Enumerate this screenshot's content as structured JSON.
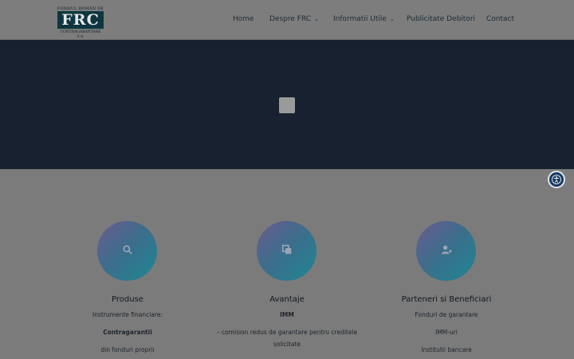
{
  "header": {
    "logo": {
      "top_text": "FONDUL ROMÂN DE",
      "mark": "FRC",
      "bottom_text": "CONTRAGARANTARE S.A."
    },
    "nav": [
      {
        "label": "Home",
        "has_dropdown": false
      },
      {
        "label": "Despre FRC",
        "has_dropdown": true
      },
      {
        "label": "Informatii Utile",
        "has_dropdown": true
      },
      {
        "label": "Publicitate Debitori",
        "has_dropdown": false
      },
      {
        "label": "Contact",
        "has_dropdown": false
      }
    ]
  },
  "hero": {
    "background_color": "#172130",
    "placeholder_icon": "image-placeholder-icon"
  },
  "accessibility": {
    "icon": "accessibility-icon",
    "color": "#133a66"
  },
  "features": [
    {
      "icon": "search-icon",
      "title": "Produse",
      "lines": [
        "Instrumente financiare:",
        "Contragarantii",
        "din fonduri proprii"
      ]
    },
    {
      "icon": "copy-icon",
      "title": "Avantaje",
      "lines": [
        "IMM",
        "– comision redus de garantare pentru creditele",
        "solicitate"
      ]
    },
    {
      "icon": "add-user-icon",
      "title": "Parteneri si Beneficiari",
      "lines": [
        "Fonduri de garantare",
        "IMM-uri",
        "Institutii bancare"
      ]
    }
  ],
  "colors": {
    "overlay_gray": "#7b7b7b",
    "circle_gradient_start": "#6a5a8e",
    "circle_gradient_end": "#1e8792",
    "text_dark": "#1d2b36"
  }
}
